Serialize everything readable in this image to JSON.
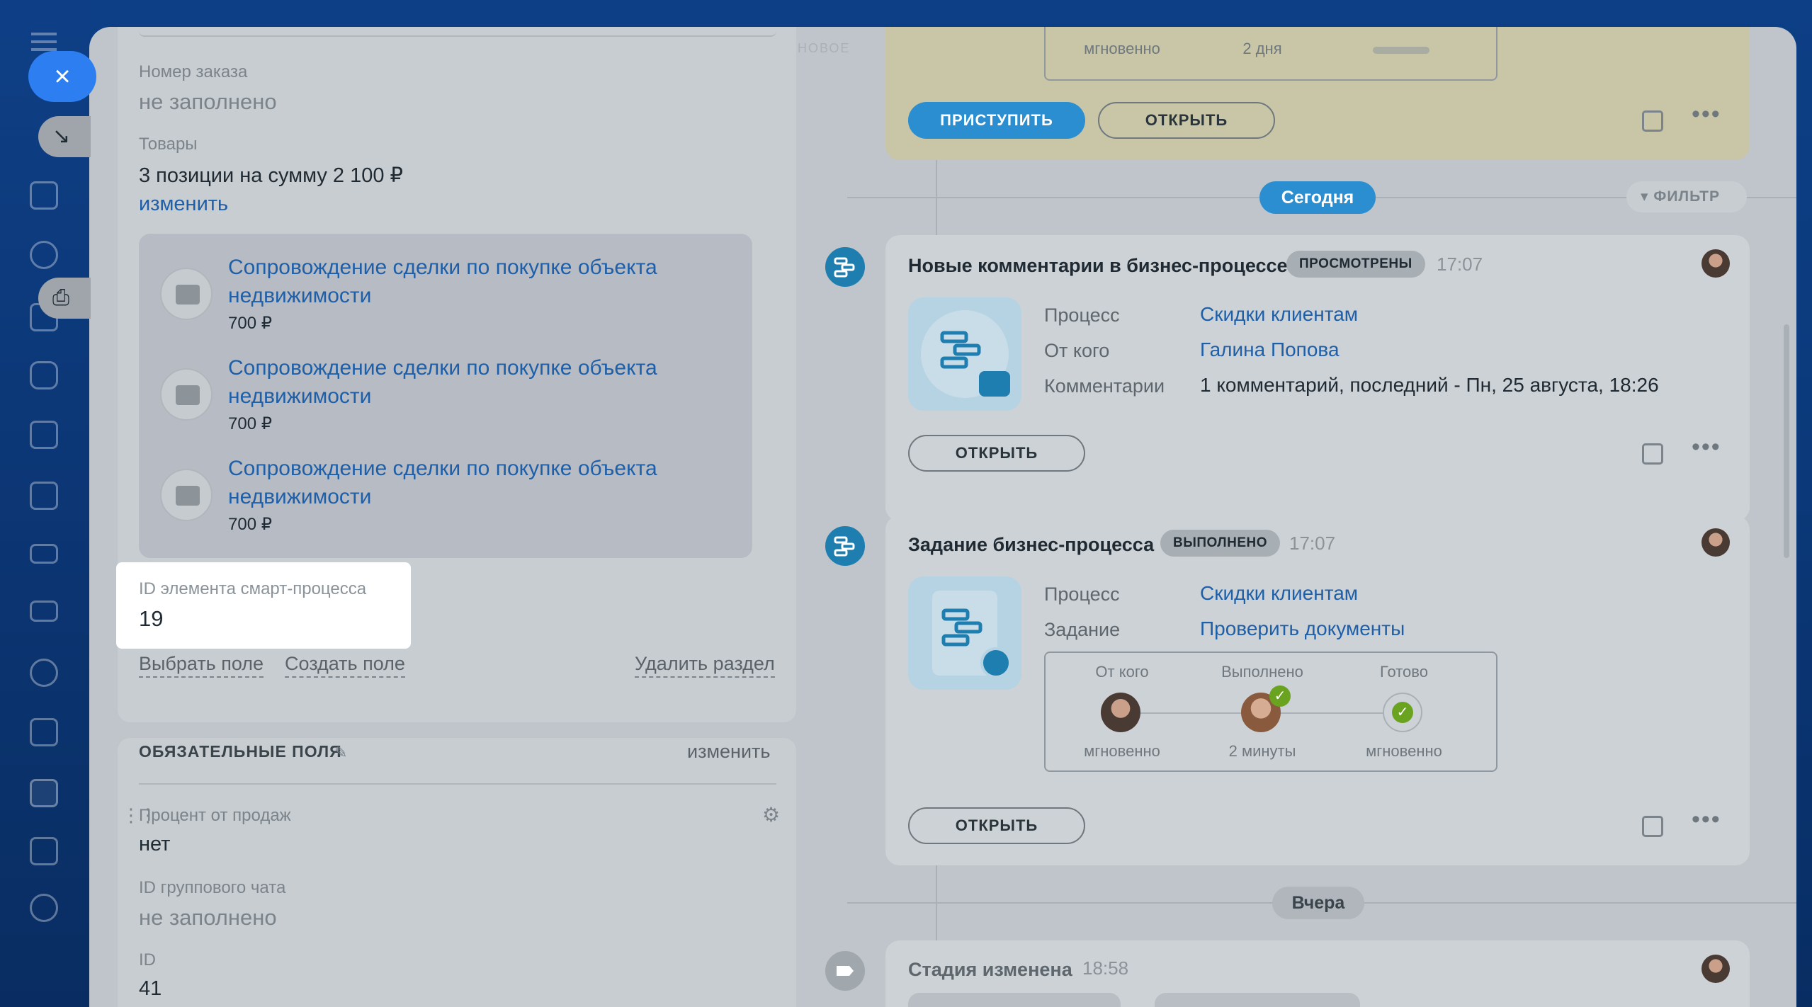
{
  "left": {
    "order_number_label": "Номер заказа",
    "order_number_value": "не заполнено",
    "goods_label": "Товары",
    "goods_summary": "3 позиции на сумму 2 100 ₽",
    "goods_change": "изменить",
    "products": [
      {
        "title": "Сопровождение сделки по покупке объекта недвижимости",
        "price": "700 ₽"
      },
      {
        "title": "Сопровождение сделки по покупке объекта недвижимости",
        "price": "700 ₽"
      },
      {
        "title": "Сопровождение сделки по покупке объекта недвижимости",
        "price": "700 ₽"
      }
    ],
    "id_label": "ID элемента смарт-процесса",
    "id_value": "19",
    "select_field": "Выбрать поле",
    "create_field": "Создать поле",
    "delete_section": "Удалить раздел",
    "required_title": "ОБЯЗАТЕЛЬНЫЕ ПОЛЯ",
    "required_change": "изменить",
    "percent_label": "Процент от продаж",
    "percent_value": "нет",
    "chat_label": "ID группового чата",
    "chat_value": "не заполнено",
    "id2_label": "ID",
    "id2_value": "41"
  },
  "top_label": "НОВОЕ",
  "top_card": {
    "stat_instant": "мгновенно",
    "stat_days": "2 дня",
    "start_btn": "ПРИСТУПИТЬ",
    "open_btn": "ОТКРЫТЬ"
  },
  "today_label": "Сегодня",
  "filter_label": "ФИЛЬТР",
  "card1": {
    "title": "Новые комментарии в бизнес-процессе",
    "badge": "ПРОСМОТРЕНЫ",
    "time": "17:07",
    "k1": "Процесс",
    "v1": "Скидки клиентам",
    "k2": "От кого",
    "v2": "Галина Попова",
    "k3": "Комментарии",
    "v3": "1 комментарий, последний - Пн, 25 августа, 18:26",
    "open_btn": "ОТКРЫТЬ"
  },
  "card2": {
    "title": "Задание бизнес-процесса",
    "badge": "ВЫПОЛНЕНО",
    "time": "17:07",
    "k1": "Процесс",
    "v1": "Скидки клиентам",
    "k2": "Задание",
    "v2": "Проверить документы",
    "stats": [
      {
        "head": "От кого",
        "foot": "мгновенно"
      },
      {
        "head": "Выполнено",
        "foot": "2 минуты"
      },
      {
        "head": "Готово",
        "foot": "мгновенно"
      }
    ],
    "open_btn": "ОТКРЫТЬ"
  },
  "yesterday_label": "Вчера",
  "card3": {
    "title": "Стадия изменена",
    "time": "18:58"
  },
  "colors": {
    "accent": "#2b8ed0",
    "link": "#1e5fa8",
    "success": "#6aa320",
    "overlay": "#bfc5ca"
  }
}
